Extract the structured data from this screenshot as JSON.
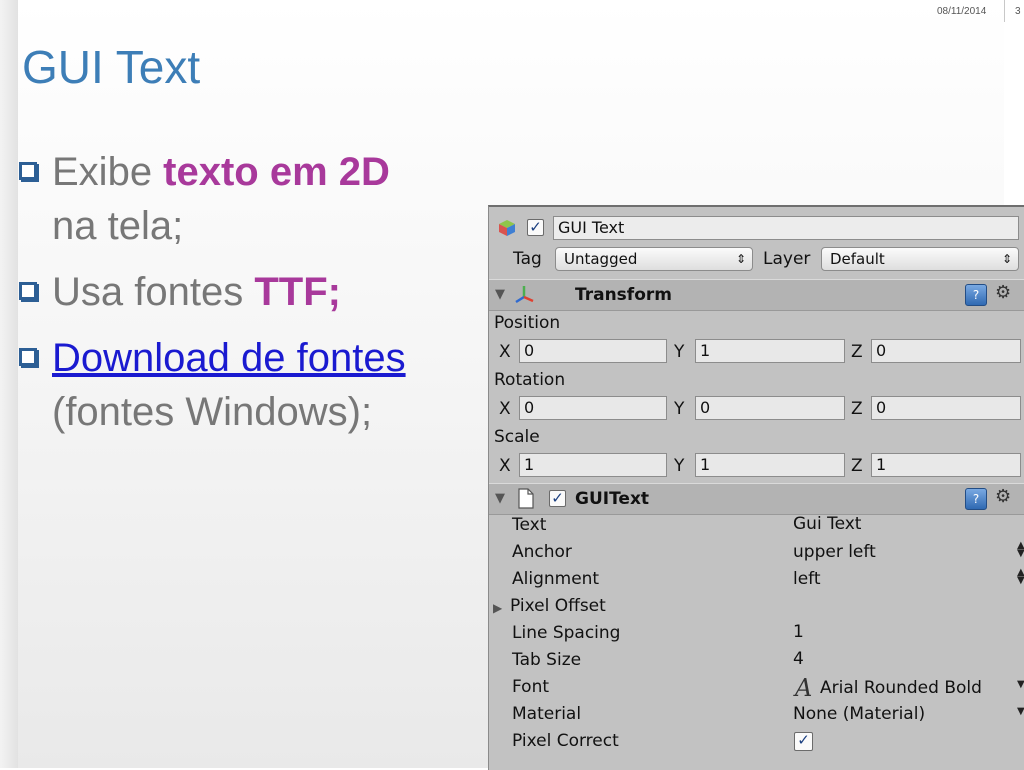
{
  "slide": {
    "date": "08/11/2014",
    "page_number": "3",
    "title": "GUI Text",
    "bullets": {
      "b1_pre": "Exibe ",
      "b1_hl": "texto em 2D",
      "b1_post": "na tela;",
      "b2_pre": "Usa fontes ",
      "b2_hl": "TTF;",
      "b3_link": "Download de fontes",
      "b3_post": "(fontes Windows);"
    }
  },
  "inspector": {
    "object_name": "GUI Text",
    "active_checked": true,
    "tag_label": "Tag",
    "tag_value": "Untagged",
    "layer_label": "Layer",
    "layer_value": "Default",
    "transform": {
      "title": "Transform",
      "position_label": "Position",
      "rotation_label": "Rotation",
      "scale_label": "Scale",
      "x_label": "X",
      "y_label": "Y",
      "z_label": "Z",
      "position": {
        "x": "0",
        "y": "1",
        "z": "0"
      },
      "rotation": {
        "x": "0",
        "y": "0",
        "z": "0"
      },
      "scale": {
        "x": "1",
        "y": "1",
        "z": "1"
      }
    },
    "guitext": {
      "title": "GUIText",
      "enabled": true,
      "props": {
        "text_label": "Text",
        "text_value": "Gui Text",
        "anchor_label": "Anchor",
        "anchor_value": "upper left",
        "alignment_label": "Alignment",
        "alignment_value": "left",
        "pixel_offset_label": "Pixel Offset",
        "line_spacing_label": "Line Spacing",
        "line_spacing_value": "1",
        "tab_size_label": "Tab Size",
        "tab_size_value": "4",
        "font_label": "Font",
        "font_value": "Arial Rounded Bold",
        "material_label": "Material",
        "material_value": "None (Material)",
        "pixel_correct_label": "Pixel Correct",
        "pixel_correct_checked": true
      }
    },
    "icons": {
      "gameobject": "cube-icon",
      "transform": "transform-axes-icon",
      "guitext": "document-icon",
      "font": "font-icon",
      "help": "help-icon",
      "settings": "gear-icon"
    }
  }
}
